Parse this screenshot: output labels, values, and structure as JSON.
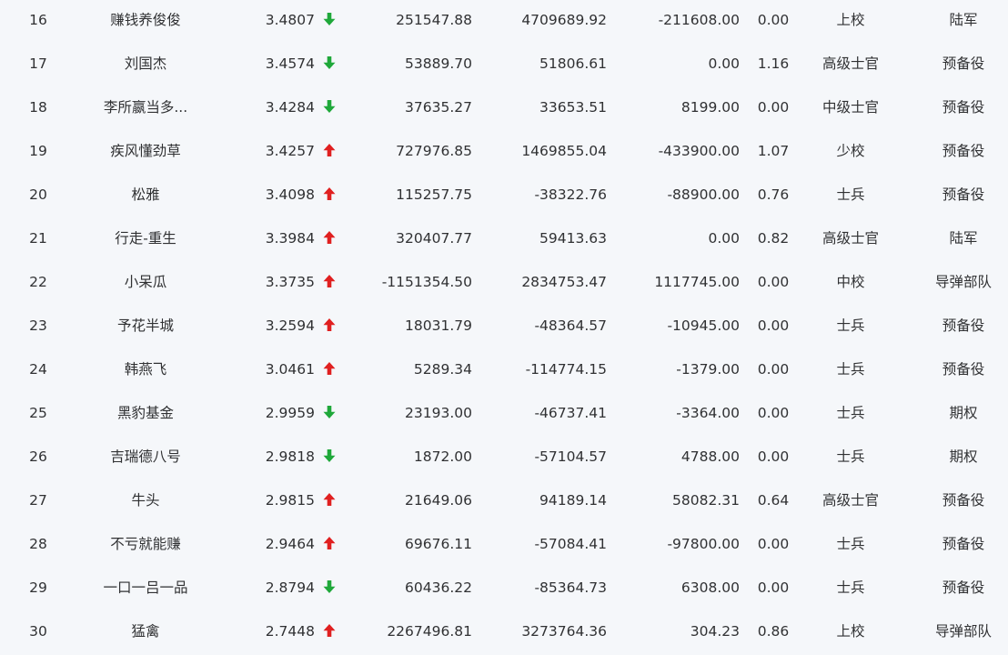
{
  "colors": {
    "up": "#e02020",
    "down": "#1fa83a"
  },
  "rows": [
    {
      "rank": "16",
      "name": "赚钱养俊俊",
      "value": "3.4807",
      "trend": "down",
      "col_a": "251547.88",
      "col_b": "4709689.92",
      "col_c": "-211608.00",
      "col_d": "0.00",
      "military_rank": "上校",
      "category": "陆军"
    },
    {
      "rank": "17",
      "name": "刘国杰",
      "value": "3.4574",
      "trend": "down",
      "col_a": "53889.70",
      "col_b": "51806.61",
      "col_c": "0.00",
      "col_d": "1.16",
      "military_rank": "高级士官",
      "category": "预备役"
    },
    {
      "rank": "18",
      "name": "李所嬴当多...",
      "value": "3.4284",
      "trend": "down",
      "col_a": "37635.27",
      "col_b": "33653.51",
      "col_c": "8199.00",
      "col_d": "0.00",
      "military_rank": "中级士官",
      "category": "预备役"
    },
    {
      "rank": "19",
      "name": "疾风懂劲草",
      "value": "3.4257",
      "trend": "up",
      "col_a": "727976.85",
      "col_b": "1469855.04",
      "col_c": "-433900.00",
      "col_d": "1.07",
      "military_rank": "少校",
      "category": "预备役"
    },
    {
      "rank": "20",
      "name": "松雅",
      "value": "3.4098",
      "trend": "up",
      "col_a": "115257.75",
      "col_b": "-38322.76",
      "col_c": "-88900.00",
      "col_d": "0.76",
      "military_rank": "士兵",
      "category": "预备役"
    },
    {
      "rank": "21",
      "name": "行走-重生",
      "value": "3.3984",
      "trend": "up",
      "col_a": "320407.77",
      "col_b": "59413.63",
      "col_c": "0.00",
      "col_d": "0.82",
      "military_rank": "高级士官",
      "category": "陆军"
    },
    {
      "rank": "22",
      "name": "小呆瓜",
      "value": "3.3735",
      "trend": "up",
      "col_a": "-1151354.50",
      "col_b": "2834753.47",
      "col_c": "1117745.00",
      "col_d": "0.00",
      "military_rank": "中校",
      "category": "导弹部队"
    },
    {
      "rank": "23",
      "name": "予花半城",
      "value": "3.2594",
      "trend": "up",
      "col_a": "18031.79",
      "col_b": "-48364.57",
      "col_c": "-10945.00",
      "col_d": "0.00",
      "military_rank": "士兵",
      "category": "预备役"
    },
    {
      "rank": "24",
      "name": "韩燕飞",
      "value": "3.0461",
      "trend": "up",
      "col_a": "5289.34",
      "col_b": "-114774.15",
      "col_c": "-1379.00",
      "col_d": "0.00",
      "military_rank": "士兵",
      "category": "预备役"
    },
    {
      "rank": "25",
      "name": "黑豹基金",
      "value": "2.9959",
      "trend": "down",
      "col_a": "23193.00",
      "col_b": "-46737.41",
      "col_c": "-3364.00",
      "col_d": "0.00",
      "military_rank": "士兵",
      "category": "期权"
    },
    {
      "rank": "26",
      "name": "吉瑞德八号",
      "value": "2.9818",
      "trend": "down",
      "col_a": "1872.00",
      "col_b": "-57104.57",
      "col_c": "4788.00",
      "col_d": "0.00",
      "military_rank": "士兵",
      "category": "期权"
    },
    {
      "rank": "27",
      "name": "牛头",
      "value": "2.9815",
      "trend": "up",
      "col_a": "21649.06",
      "col_b": "94189.14",
      "col_c": "58082.31",
      "col_d": "0.64",
      "military_rank": "高级士官",
      "category": "预备役"
    },
    {
      "rank": "28",
      "name": "不亏就能赚",
      "value": "2.9464",
      "trend": "up",
      "col_a": "69676.11",
      "col_b": "-57084.41",
      "col_c": "-97800.00",
      "col_d": "0.00",
      "military_rank": "士兵",
      "category": "预备役"
    },
    {
      "rank": "29",
      "name": "一口一吕一品",
      "value": "2.8794",
      "trend": "down",
      "col_a": "60436.22",
      "col_b": "-85364.73",
      "col_c": "6308.00",
      "col_d": "0.00",
      "military_rank": "士兵",
      "category": "预备役"
    },
    {
      "rank": "30",
      "name": "猛禽",
      "value": "2.7448",
      "trend": "up",
      "col_a": "2267496.81",
      "col_b": "3273764.36",
      "col_c": "304.23",
      "col_d": "0.86",
      "military_rank": "上校",
      "category": "导弹部队"
    }
  ]
}
